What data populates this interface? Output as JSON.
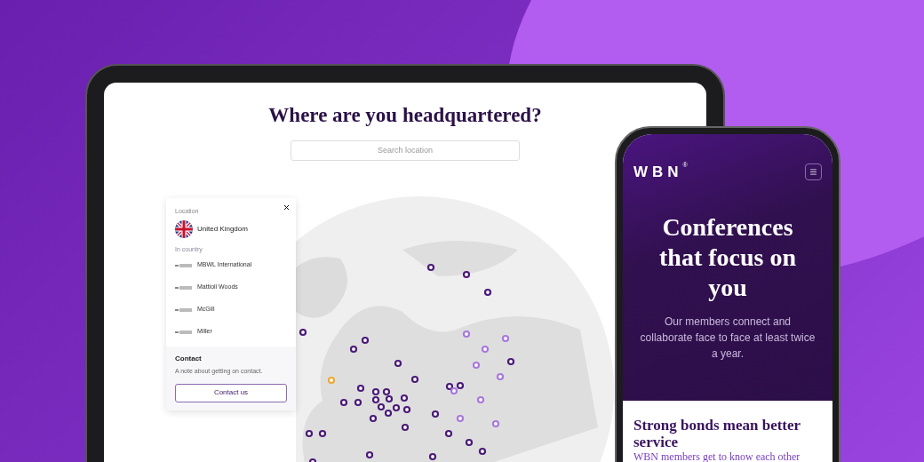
{
  "tablet": {
    "title": "Where are you headquartered?",
    "search": {
      "placeholder": "Search location"
    },
    "popup": {
      "location_label": "Location",
      "country": "United Kingdom",
      "in_country_label": "In country",
      "members": [
        {
          "name": "MBWL International"
        },
        {
          "name": "Mattioli Woods"
        },
        {
          "name": "McGill"
        },
        {
          "name": "Miller"
        }
      ],
      "contact": {
        "title": "Contact",
        "note": "A note about getting on contact.",
        "button": "Contact us"
      }
    }
  },
  "phone": {
    "logo": "WBN",
    "logo_mark": "®",
    "hero": {
      "title": "Conferences that focus on you",
      "text": "Our members connect and collaborate face to face at least twice a year."
    },
    "section": {
      "title": "Strong bonds mean better service",
      "text": "WBN members get to know each other"
    }
  }
}
